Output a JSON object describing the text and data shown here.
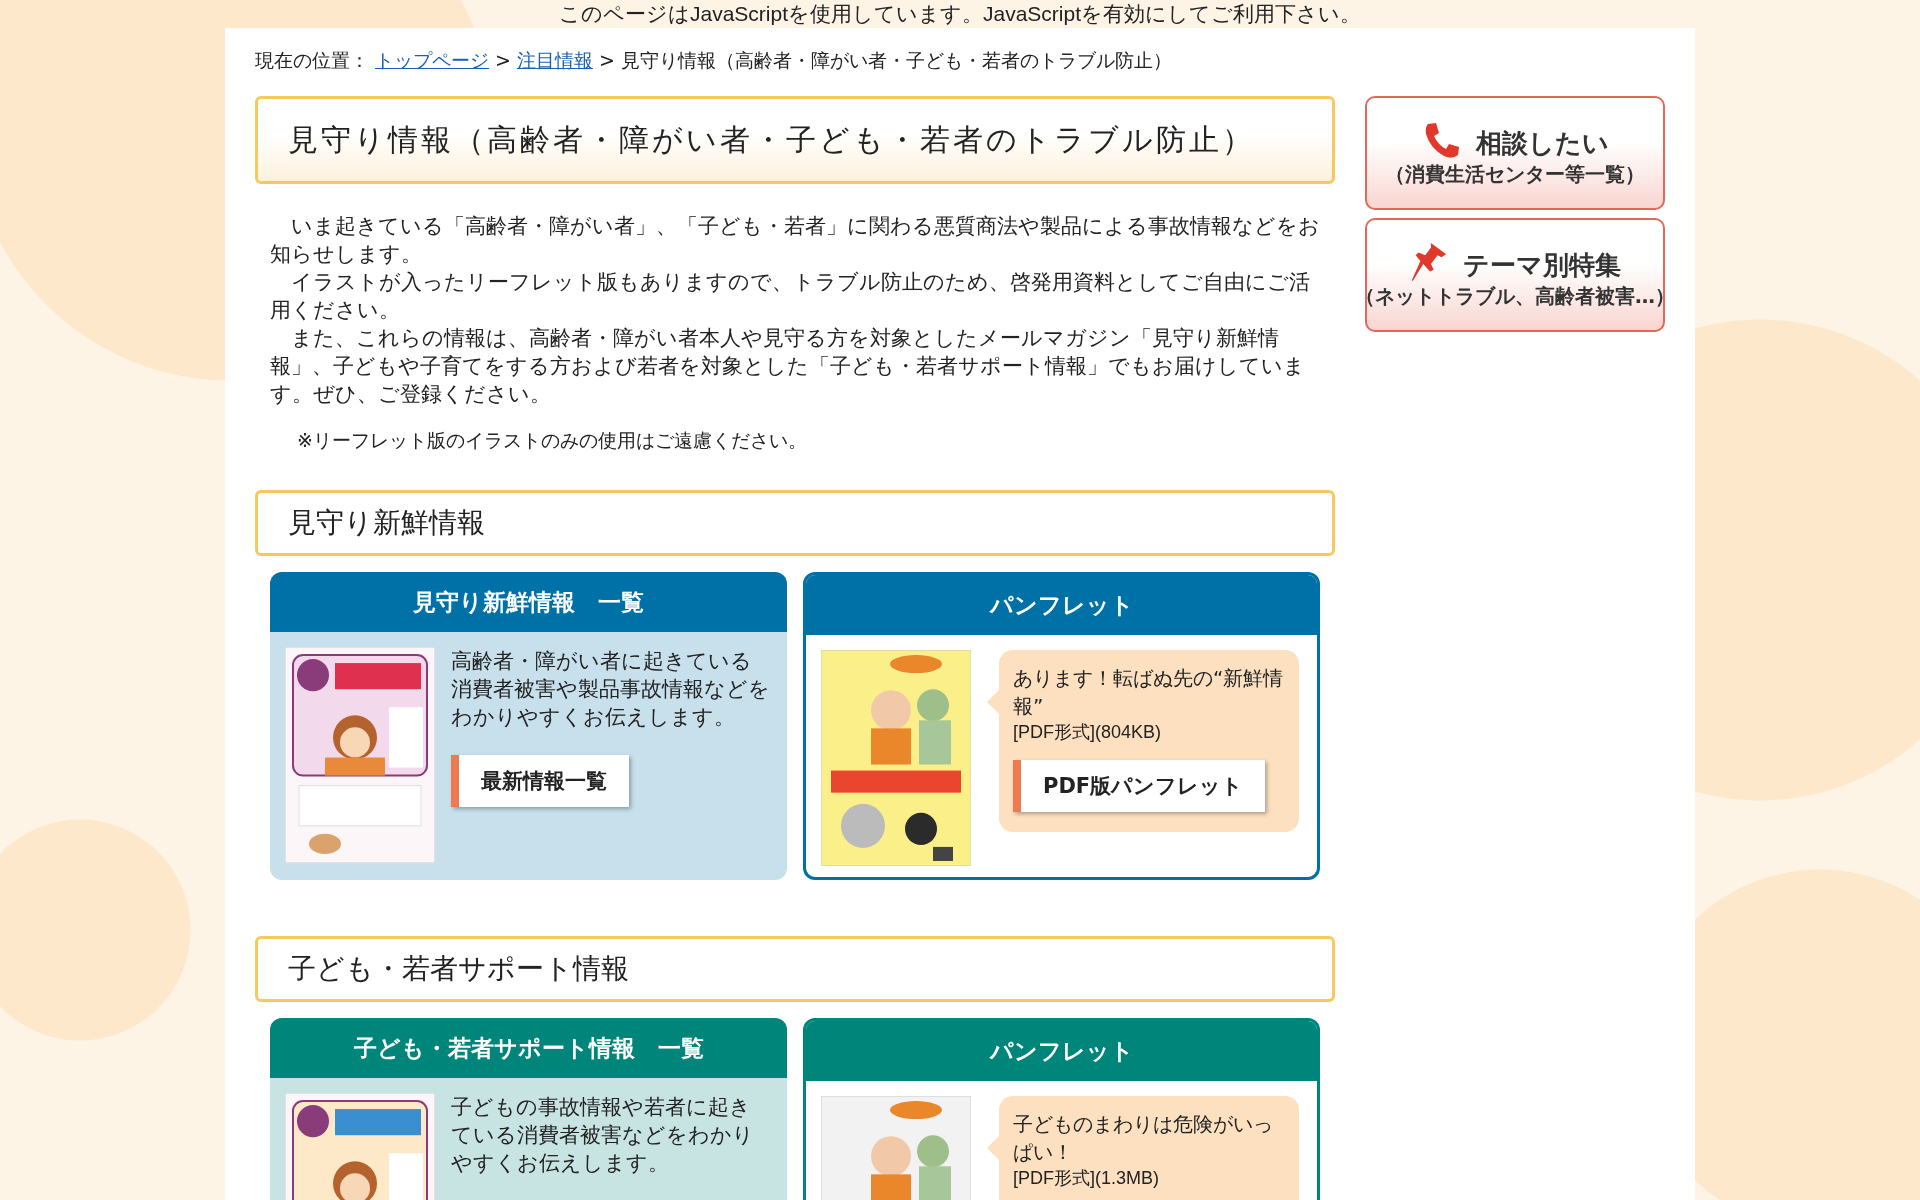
{
  "notice": "このページはJavaScriptを使用しています。JavaScriptを有効にしてご利用下さい。",
  "breadcrumb": [
    {
      "kind": "label",
      "text": "現在の位置："
    },
    {
      "kind": "link",
      "text": "トップページ"
    },
    {
      "kind": "sep",
      "text": ">"
    },
    {
      "kind": "link",
      "text": "注目情報"
    },
    {
      "kind": "sep",
      "text": ">"
    },
    {
      "kind": "current",
      "text": "見守り情報（高齢者・障がい者・子ども・若者のトラブル防止）"
    }
  ],
  "page_title": "見守り情報（高齢者・障がい者・子ども・若者のトラブル防止）",
  "intro": [
    "いま起きている「高齢者・障がい者」、「子ども・若者」に関わる悪質商法や製品による事故情報などをお知らせします。",
    "イラストが入ったリーフレット版もありますので、トラブル防止のため、啓発用資料としてご自由にご活用ください。",
    "また、これらの情報は、高齢者・障がい者本人や見守る方を対象としたメールマガジン「見守り新鮮情報」、子どもや子育てをする方および若者を対象とした「子ども・若者サポート情報」でもお届けしています。ぜひ、ご登録ください。"
  ],
  "note": "※リーフレット版のイラストのみの使用はご遠慮ください。",
  "side_buttons": [
    {
      "kind": "phone",
      "title": "相談したい",
      "subtitle": "（消費生活センター等一覧）"
    },
    {
      "kind": "pin",
      "title": "テーマ別特集",
      "subtitle": "（ネットトラブル、高齢者被害…）"
    }
  ],
  "sections": [
    {
      "heading": "見守り新鮮情報",
      "color": "#0071a7",
      "list_card": {
        "heading": "見守り新鮮情報　一覧",
        "description": "高齢者・障がい者に起きている消費者被害や製品事故情報などをわかりやすくお伝えします。",
        "button": "最新情報一覧"
      },
      "pamphlet_card": {
        "heading": "パンフレット",
        "title": "あります！転ばぬ先の“新鮮情報”",
        "file_info": "[PDF形式](804KB)",
        "button": "PDF版パンフレット"
      }
    },
    {
      "heading": "子ども・若者サポート情報",
      "color": "#00857a",
      "list_card": {
        "heading": "子ども・若者サポート情報　一覧",
        "description": "子どもの事故情報や若者に起きている消費者被害などをわかりやすくお伝えします。"
      },
      "pamphlet_card": {
        "heading": "パンフレット",
        "title": "子どものまわりは危険がいっぱい！",
        "file_info": "[PDF形式](1.3MB)"
      }
    }
  ]
}
